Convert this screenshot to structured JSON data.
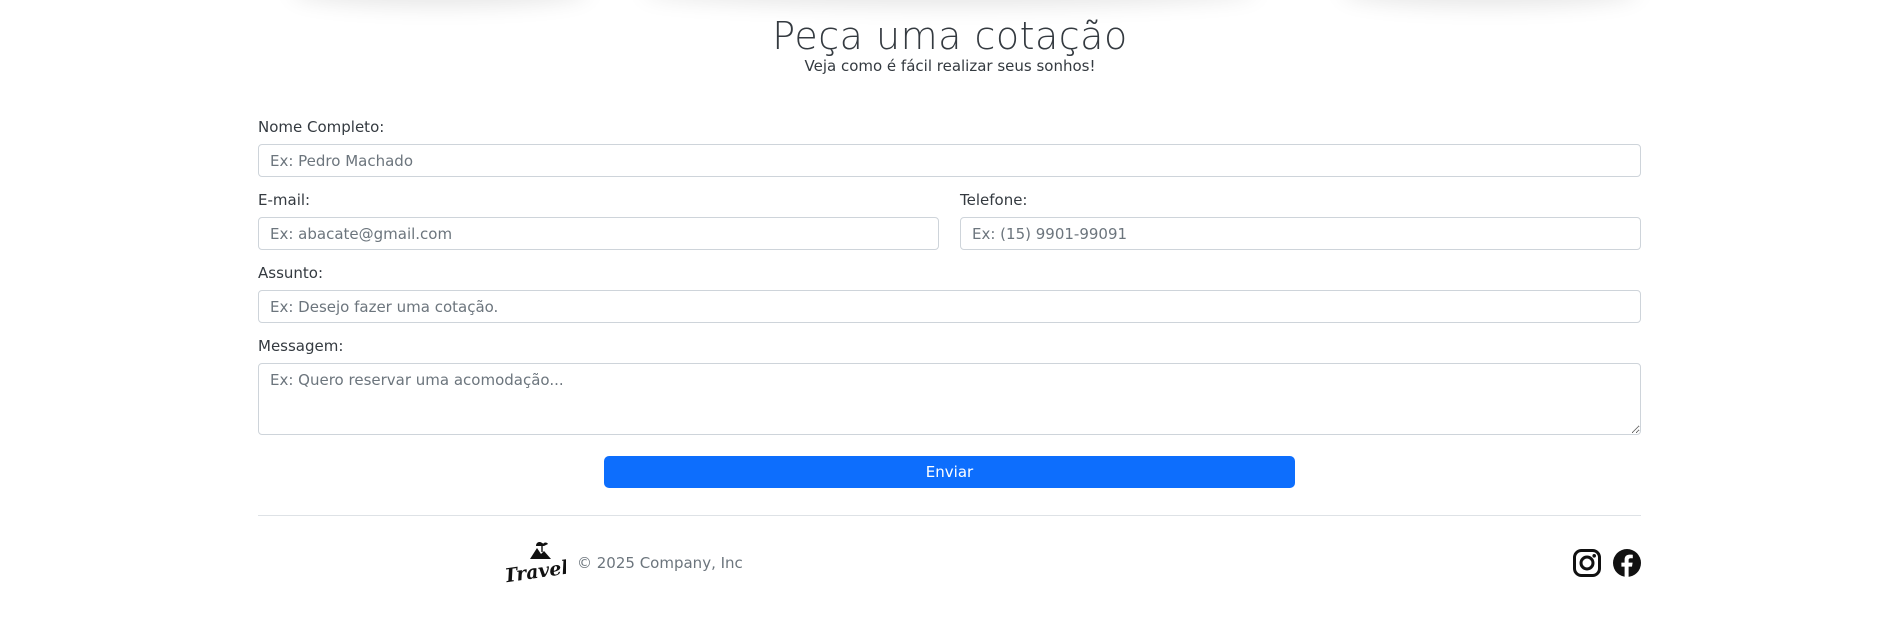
{
  "form": {
    "title": "Peça uma cotação",
    "subtitle": "Veja como é fácil realizar seus sonhos!",
    "name": {
      "label": "Nome Completo:",
      "placeholder": "Ex: Pedro Machado",
      "value": ""
    },
    "email": {
      "label": "E-mail:",
      "placeholder": "Ex: abacate@gmail.com",
      "value": ""
    },
    "phone": {
      "label": "Telefone:",
      "placeholder": "Ex: (15) 9901-99091",
      "value": ""
    },
    "subject": {
      "label": "Assunto:",
      "placeholder": "Ex: Desejo fazer uma cotação.",
      "value": ""
    },
    "message": {
      "label": "Messagem:",
      "placeholder": "Ex: Quero reservar uma acomodação...",
      "value": ""
    },
    "submit_label": "Enviar"
  },
  "footer": {
    "logo_text": "Travel",
    "copyright": "© 2025 Company, Inc",
    "social": [
      {
        "name": "instagram-icon"
      },
      {
        "name": "facebook-icon"
      }
    ]
  },
  "colors": {
    "primary": "#0d6efd",
    "text": "#343a40",
    "muted": "#6c757d",
    "border": "#ced4da"
  }
}
